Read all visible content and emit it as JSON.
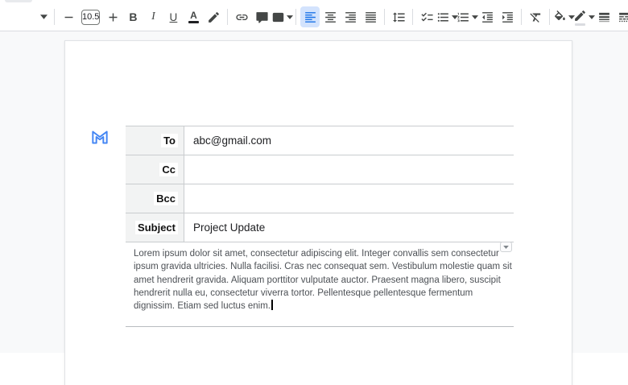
{
  "toolbar": {
    "font_size": "10.5",
    "items": [
      {
        "type": "icon",
        "name": "font-family-dropdown",
        "icon": "chevron-down",
        "small": true
      },
      {
        "type": "divider"
      },
      {
        "type": "icon",
        "name": "decrease-font-size-button",
        "icon": "minus"
      },
      {
        "type": "value",
        "name": "font-size-input"
      },
      {
        "type": "icon",
        "name": "increase-font-size-button",
        "icon": "plus"
      },
      {
        "type": "glyph",
        "name": "bold-button",
        "glyph": "B",
        "cls": "g-bold"
      },
      {
        "type": "glyph",
        "name": "italic-button",
        "glyph": "I",
        "cls": "g-italic"
      },
      {
        "type": "glyph",
        "name": "underline-button",
        "glyph": "U",
        "cls": "g-underline"
      },
      {
        "type": "glyph",
        "name": "text-color-button",
        "glyph": "A",
        "cls": "g-textcolor",
        "bar": "#202124"
      },
      {
        "type": "icon",
        "name": "highlight-color-button",
        "icon": "highlighter"
      },
      {
        "type": "divider"
      },
      {
        "type": "icon",
        "name": "insert-link-button",
        "icon": "link"
      },
      {
        "type": "icon",
        "name": "add-comment-button",
        "icon": "add-comment"
      },
      {
        "type": "icon",
        "name": "insert-image-button",
        "icon": "image",
        "chevron": true
      },
      {
        "type": "divider"
      },
      {
        "type": "icon",
        "name": "align-left-button",
        "icon": "align-left",
        "selected": true
      },
      {
        "type": "icon",
        "name": "align-center-button",
        "icon": "align-center"
      },
      {
        "type": "icon",
        "name": "align-right-button",
        "icon": "align-right"
      },
      {
        "type": "icon",
        "name": "align-justify-button",
        "icon": "align-justify"
      },
      {
        "type": "divider"
      },
      {
        "type": "icon",
        "name": "line-spacing-button",
        "icon": "line-spacing"
      },
      {
        "type": "divider"
      },
      {
        "type": "icon",
        "name": "checklist-button",
        "icon": "checklist"
      },
      {
        "type": "icon",
        "name": "bulleted-list-button",
        "icon": "bulleted-list",
        "chevron": true
      },
      {
        "type": "icon",
        "name": "numbered-list-button",
        "icon": "numbered-list",
        "chevron": true
      },
      {
        "type": "icon",
        "name": "decrease-indent-button",
        "icon": "decrease-indent"
      },
      {
        "type": "icon",
        "name": "increase-indent-button",
        "icon": "increase-indent"
      },
      {
        "type": "divider"
      },
      {
        "type": "icon",
        "name": "clear-formatting-button",
        "icon": "clear-formatting"
      },
      {
        "type": "divider"
      },
      {
        "type": "icon",
        "name": "fill-color-button",
        "icon": "fill-color",
        "chevron": true
      },
      {
        "type": "icon",
        "name": "border-color-button",
        "icon": "border-color",
        "chevron": true,
        "bar": "#dadce0"
      },
      {
        "type": "icon",
        "name": "border-width-button",
        "icon": "border-width"
      },
      {
        "type": "icon",
        "name": "border-dash-button",
        "icon": "border-dash"
      },
      {
        "type": "divider"
      }
    ]
  },
  "email_draft": {
    "fields": [
      {
        "label": "To",
        "value": "abc@gmail.com"
      },
      {
        "label": "Cc",
        "value": ""
      },
      {
        "label": "Bcc",
        "value": ""
      },
      {
        "label": "Subject",
        "value": "Project Update"
      }
    ],
    "body_lines": [
      "Lorem ipsum dolor sit amet, consectetur adipiscing elit. Integer convallis sem consectetur",
      "ipsum gravida ultricies. Nulla facilisi. Cras nec consequat sem. Vestibulum molestie quam sit",
      "amet hendrerit gravida. Aliquam porttitor vulputate auctor. Praesent magna libero, suscipit",
      "hendrerit nulla eu, consectetur viverra tortor. Pellentesque pellentesque fermentum",
      "dignissim. Etiam sed luctus enim."
    ]
  },
  "colors": {
    "accent_blue": "#1a73e8",
    "selected_bg": "#d3e3fd",
    "icon_color": "#444746",
    "gmail_blue": "#4285f4",
    "canvas_bg": "#f8f9fa",
    "toolbar_border": "#dadce0",
    "table_border": "#c9cccf",
    "label_bg": "#f2f3f3",
    "value_text": "#202124",
    "body_text": "#4d5156",
    "rule": "#b8bcc0"
  }
}
